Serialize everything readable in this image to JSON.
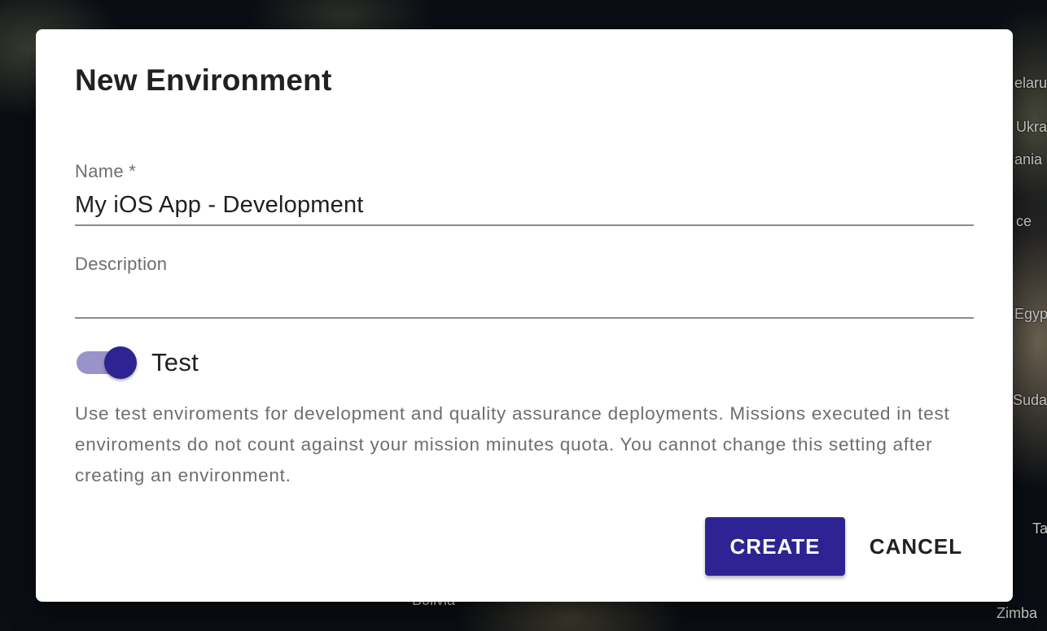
{
  "background": {
    "map_labels": [
      "elaru",
      "Ukra",
      "ania",
      "ce",
      "Egyp",
      "Suda",
      "Ta",
      "Zimba",
      "Bolivia"
    ]
  },
  "dialog": {
    "title": "New Environment",
    "name_field": {
      "label": "Name *",
      "value": "My iOS App - Development"
    },
    "description_field": {
      "label": "Description",
      "value": ""
    },
    "test_toggle": {
      "label": "Test",
      "checked": true
    },
    "helper_text": "Use test enviroments for development and quality assurance deployments. Missions executed in test enviroments do not count against your mission minutes quota. You cannot change this setting after creating an environment.",
    "create_label": "CREATE",
    "cancel_label": "CANCEL"
  },
  "colors": {
    "primary": "#2e2392",
    "track": "#9a93c9"
  }
}
